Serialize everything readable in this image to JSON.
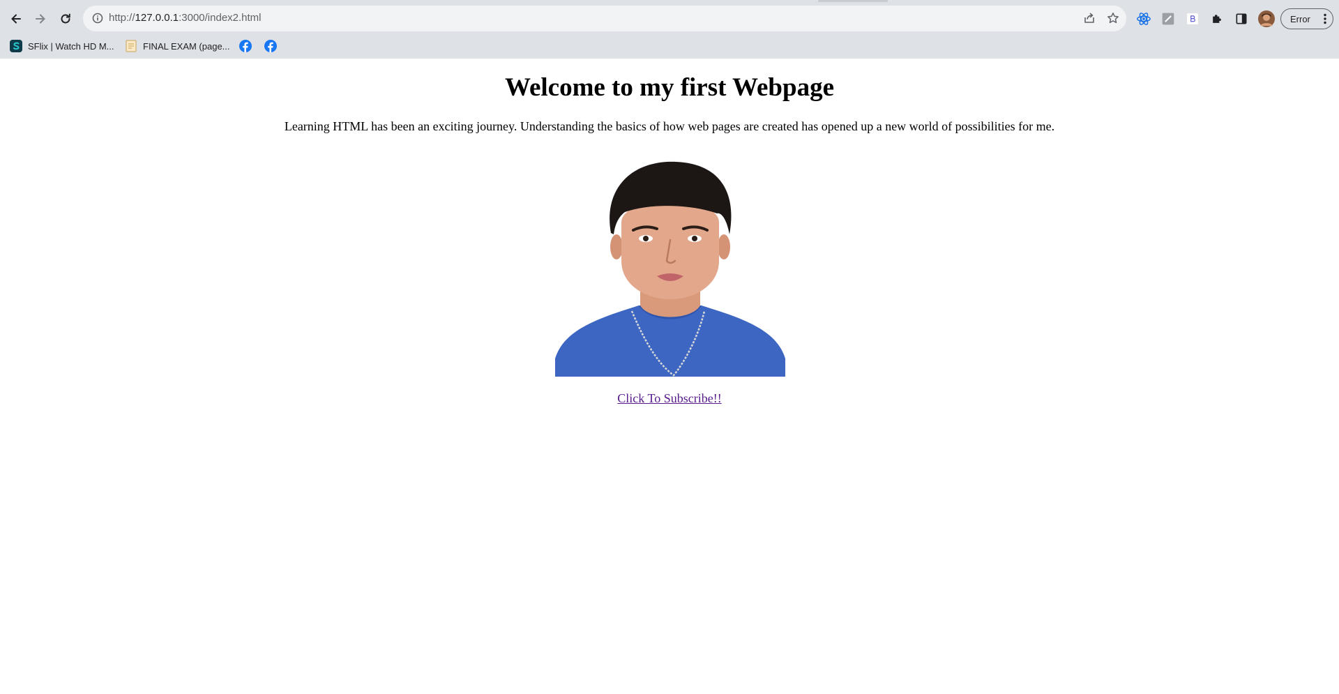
{
  "browser": {
    "url_scheme": "http://",
    "url_host": "127.0.0.1",
    "url_rest": ":3000/index2.html",
    "profile_status": "Error",
    "bookmarks": [
      {
        "label": "SFlix | Watch HD M...",
        "icon": "sflix-favicon"
      },
      {
        "label": "FINAL EXAM (page...",
        "icon": "document-favicon"
      },
      {
        "label": "",
        "icon": "facebook-icon"
      },
      {
        "label": "",
        "icon": "facebook-icon"
      }
    ],
    "colors": {
      "chrome": "#dee1e6",
      "omnibox": "#f1f3f4",
      "facebook": "#1877f2"
    }
  },
  "page": {
    "heading": "Welcome to my first Webpage",
    "intro": "Learning HTML has been an exciting journey. Understanding the basics of how web pages are created has opened up a new world of possibilities for me.",
    "photo": {
      "icon": "portrait-photo",
      "shirt_color": "#3d66c2",
      "background": "#ffffff"
    },
    "link_text": "Click To Subscribe!!",
    "link_color": "#551a8b"
  }
}
